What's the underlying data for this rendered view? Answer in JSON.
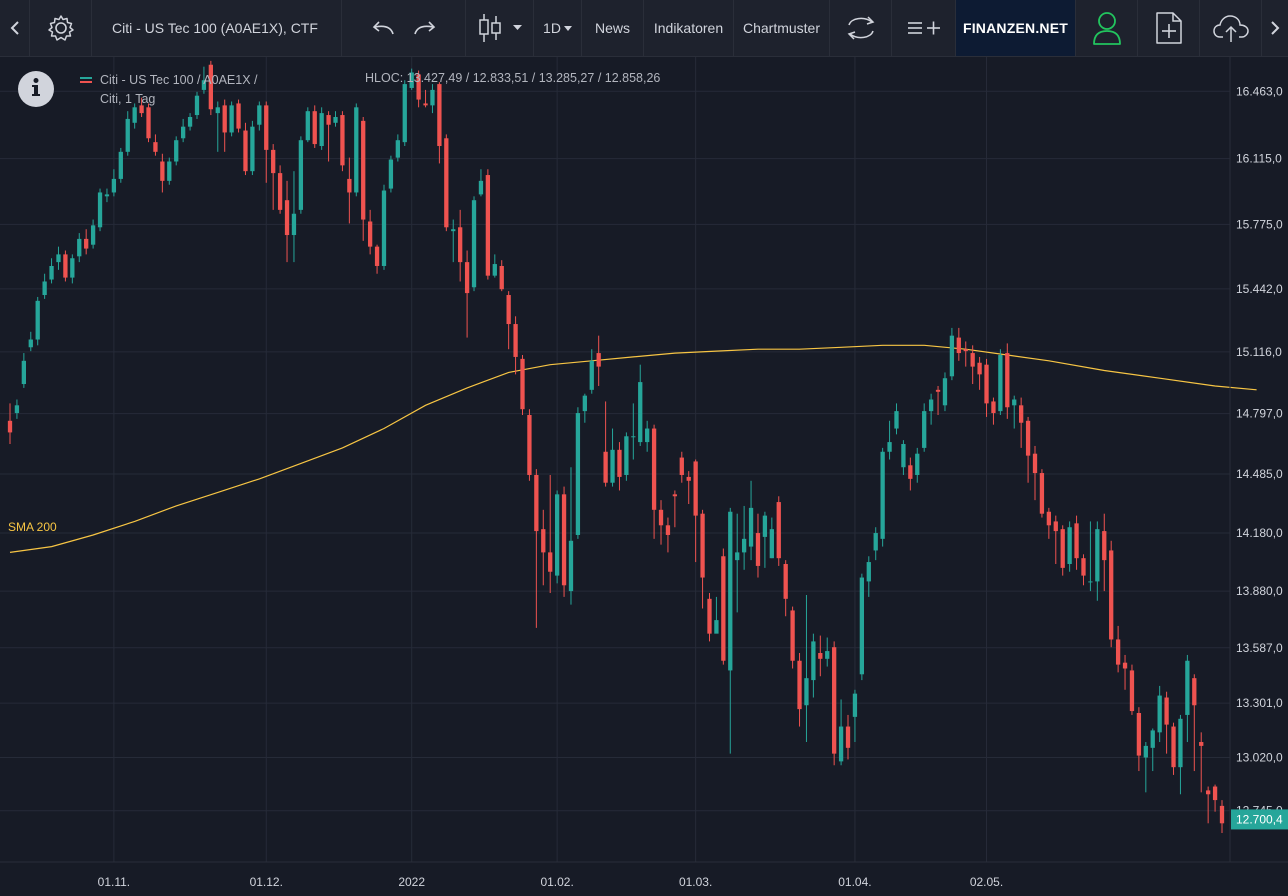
{
  "toolbar": {
    "symbol_title": "Citi - US Tec 100 (A0AE1X), CTF",
    "interval": "1D",
    "news": "News",
    "indicators": "Indikatoren",
    "patterns": "Chartmuster",
    "brand": "FINANZEN.NET"
  },
  "legend": {
    "line1": "Citi - US Tec 100 / A0AE1X /",
    "line2": "Citi, 1 Tag",
    "hloc": "HLOC: 13.427,49 / 12.833,51 / 13.285,27 / 12.858,26"
  },
  "sma_label": "SMA 200",
  "colors": {
    "up": "#26a69a",
    "down": "#ef5350",
    "sma": "#f7c544",
    "background": "#171b26",
    "grid": "#262b38"
  },
  "chart_data": {
    "type": "candlestick",
    "ylim": [
      12480,
      16640
    ],
    "y_ticks": [
      {
        "value": 16463,
        "label": "16.463,0"
      },
      {
        "value": 16115,
        "label": "16.115,0"
      },
      {
        "value": 15775,
        "label": "15.775,0"
      },
      {
        "value": 15442,
        "label": "15.442,0"
      },
      {
        "value": 15116,
        "label": "15.116,0"
      },
      {
        "value": 14797,
        "label": "14.797,0"
      },
      {
        "value": 14485,
        "label": "14.485,0"
      },
      {
        "value": 14180,
        "label": "14.180,0"
      },
      {
        "value": 13880,
        "label": "13.880,0"
      },
      {
        "value": 13587,
        "label": "13.587,0"
      },
      {
        "value": 13301,
        "label": "13.301,0"
      },
      {
        "value": 13020,
        "label": "13.020,0"
      },
      {
        "value": 12745,
        "label": "12.745,0"
      }
    ],
    "x_ticks": [
      {
        "index": 15,
        "label": "01.11."
      },
      {
        "index": 37,
        "label": "01.12."
      },
      {
        "index": 58,
        "label": "2022"
      },
      {
        "index": 79,
        "label": "01.02."
      },
      {
        "index": 99,
        "label": "01.03."
      },
      {
        "index": 122,
        "label": "01.04."
      },
      {
        "index": 141,
        "label": "02.05."
      }
    ],
    "last_price": {
      "value": 12700,
      "label": "12.700,4"
    },
    "candles": [
      [
        14760,
        14700,
        14850,
        14640
      ],
      [
        14800,
        14840,
        14870,
        14770
      ],
      [
        14950,
        15070,
        15110,
        14930
      ],
      [
        15140,
        15180,
        15220,
        15120
      ],
      [
        15180,
        15380,
        15400,
        15150
      ],
      [
        15410,
        15480,
        15520,
        15390
      ],
      [
        15490,
        15560,
        15600,
        15470
      ],
      [
        15580,
        15620,
        15660,
        15540
      ],
      [
        15620,
        15500,
        15640,
        15480
      ],
      [
        15500,
        15600,
        15620,
        15470
      ],
      [
        15610,
        15700,
        15730,
        15580
      ],
      [
        15700,
        15650,
        15750,
        15620
      ],
      [
        15670,
        15770,
        15800,
        15650
      ],
      [
        15760,
        15940,
        15960,
        15740
      ],
      [
        15920,
        15930,
        15960,
        15890
      ],
      [
        15940,
        16010,
        16060,
        15920
      ],
      [
        16010,
        16150,
        16170,
        15990
      ],
      [
        16150,
        16320,
        16360,
        16130
      ],
      [
        16300,
        16380,
        16400,
        16270
      ],
      [
        16390,
        16350,
        16430,
        16330
      ],
      [
        16380,
        16220,
        16400,
        16200
      ],
      [
        16200,
        16150,
        16240,
        16130
      ],
      [
        16100,
        16000,
        16140,
        15940
      ],
      [
        16000,
        16100,
        16120,
        15980
      ],
      [
        16100,
        16210,
        16230,
        16080
      ],
      [
        16220,
        16280,
        16320,
        16200
      ],
      [
        16280,
        16330,
        16350,
        16260
      ],
      [
        16340,
        16440,
        16460,
        16320
      ],
      [
        16470,
        16520,
        16590,
        16450
      ],
      [
        16600,
        16370,
        16620,
        16340
      ],
      [
        16350,
        16380,
        16410,
        16150
      ],
      [
        16390,
        16250,
        16420,
        16150
      ],
      [
        16250,
        16390,
        16410,
        16230
      ],
      [
        16400,
        16270,
        16420,
        16250
      ],
      [
        16260,
        16050,
        16300,
        16030
      ],
      [
        16050,
        16280,
        16310,
        16030
      ],
      [
        16290,
        16390,
        16410,
        16260
      ],
      [
        16390,
        16160,
        16410,
        15990
      ],
      [
        16160,
        16040,
        16190,
        15850
      ],
      [
        16040,
        15850,
        16080,
        15830
      ],
      [
        15900,
        15720,
        16000,
        15580
      ],
      [
        15720,
        15830,
        16050,
        15580
      ],
      [
        15850,
        16210,
        16230,
        15830
      ],
      [
        16210,
        16360,
        16380,
        16200
      ],
      [
        16360,
        16190,
        16390,
        16170
      ],
      [
        16180,
        16350,
        16380,
        16160
      ],
      [
        16340,
        16290,
        16360,
        16100
      ],
      [
        16300,
        16330,
        16360,
        16280
      ],
      [
        16340,
        16080,
        16360,
        16050
      ],
      [
        16010,
        15940,
        16120,
        15780
      ],
      [
        15940,
        16380,
        16400,
        15920
      ],
      [
        16310,
        15800,
        16330,
        15690
      ],
      [
        15790,
        15660,
        15850,
        15620
      ],
      [
        15660,
        15560,
        15670,
        15520
      ],
      [
        15560,
        15950,
        15980,
        15540
      ],
      [
        15960,
        16110,
        16130,
        15940
      ],
      [
        16120,
        16210,
        16240,
        16100
      ],
      [
        16200,
        16500,
        16520,
        16180
      ],
      [
        16480,
        16560,
        16580,
        16470
      ],
      [
        16550,
        16420,
        16570,
        16380
      ],
      [
        16400,
        16390,
        16470,
        16380
      ],
      [
        16390,
        16470,
        16500,
        16350
      ],
      [
        16500,
        16180,
        16510,
        16090
      ],
      [
        16220,
        15760,
        16240,
        15740
      ],
      [
        15740,
        15750,
        15800,
        15580
      ],
      [
        15760,
        15580,
        15850,
        15480
      ],
      [
        15580,
        15420,
        15640,
        15190
      ],
      [
        15450,
        15900,
        15920,
        15430
      ],
      [
        15930,
        16000,
        16060,
        15920
      ],
      [
        16030,
        15510,
        16060,
        15490
      ],
      [
        15510,
        15570,
        15620,
        15500
      ],
      [
        15560,
        15440,
        15590,
        15430
      ],
      [
        15410,
        15260,
        15430,
        15130
      ],
      [
        15260,
        15090,
        15300,
        15000
      ],
      [
        15080,
        14820,
        15100,
        14790
      ],
      [
        14790,
        14480,
        14820,
        14450
      ],
      [
        14480,
        14190,
        14510,
        13690
      ],
      [
        14200,
        14080,
        14300,
        13910
      ],
      [
        14080,
        13980,
        14480,
        13870
      ],
      [
        13960,
        14380,
        14400,
        13920
      ],
      [
        14380,
        13910,
        14420,
        13850
      ],
      [
        13880,
        14140,
        14520,
        13810
      ],
      [
        14170,
        14800,
        14830,
        14150
      ],
      [
        14810,
        14890,
        14900,
        14750
      ],
      [
        14920,
        15070,
        15130,
        14900
      ],
      [
        15110,
        15040,
        15200,
        14940
      ],
      [
        14600,
        14440,
        14860,
        14420
      ],
      [
        14440,
        14610,
        14720,
        14420
      ],
      [
        14610,
        14470,
        14650,
        14400
      ],
      [
        14480,
        14680,
        14700,
        14450
      ],
      [
        14680,
        14680,
        14850,
        14560
      ],
      [
        14650,
        14960,
        15050,
        14630
      ],
      [
        14650,
        14720,
        14760,
        14600
      ],
      [
        14720,
        14300,
        14740,
        14150
      ],
      [
        14300,
        14220,
        14350,
        14120
      ],
      [
        14220,
        14170,
        14260,
        14080
      ],
      [
        14380,
        14370,
        14400,
        14210
      ],
      [
        14570,
        14480,
        14600,
        14440
      ],
      [
        14470,
        14450,
        14500,
        14330
      ],
      [
        14550,
        14270,
        14560,
        14030
      ],
      [
        14280,
        13950,
        14300,
        13790
      ],
      [
        13840,
        13660,
        13870,
        13620
      ],
      [
        13660,
        13730,
        13850,
        13680
      ],
      [
        14060,
        13520,
        14100,
        13500
      ],
      [
        13470,
        14290,
        14310,
        13040
      ],
      [
        14040,
        14080,
        14280,
        13770
      ],
      [
        14080,
        14150,
        14320,
        13990
      ],
      [
        14110,
        14310,
        14450,
        14040
      ],
      [
        14180,
        14010,
        14280,
        13950
      ],
      [
        14160,
        14270,
        14290,
        14000
      ],
      [
        14050,
        14200,
        14260,
        14050
      ],
      [
        14340,
        14050,
        14370,
        14010
      ],
      [
        14020,
        13840,
        14040,
        13750
      ],
      [
        13780,
        13520,
        13800,
        13480
      ],
      [
        13520,
        13270,
        13560,
        13180
      ],
      [
        13290,
        13430,
        13860,
        13100
      ],
      [
        13420,
        13620,
        13660,
        13330
      ],
      [
        13560,
        13530,
        13650,
        13440
      ],
      [
        13530,
        13570,
        13640,
        13490
      ],
      [
        13590,
        13040,
        13620,
        12980
      ],
      [
        13000,
        13180,
        13320,
        12980
      ],
      [
        13180,
        13070,
        13240,
        13010
      ],
      [
        13230,
        13350,
        13370,
        13100
      ],
      [
        13450,
        13950,
        13970,
        13420
      ],
      [
        13930,
        14030,
        14060,
        13850
      ],
      [
        14090,
        14180,
        14210,
        14040
      ],
      [
        14150,
        14600,
        14620,
        14110
      ],
      [
        14600,
        14650,
        14760,
        14560
      ],
      [
        14720,
        14810,
        14850,
        14690
      ],
      [
        14520,
        14640,
        14660,
        14480
      ],
      [
        14530,
        14460,
        14570,
        14400
      ],
      [
        14480,
        14590,
        14620,
        14440
      ],
      [
        14620,
        14810,
        14850,
        14600
      ],
      [
        14810,
        14870,
        14900,
        14740
      ],
      [
        14920,
        14910,
        14940,
        14790
      ],
      [
        14840,
        14980,
        15010,
        14810
      ],
      [
        14990,
        15200,
        15240,
        14970
      ],
      [
        15190,
        15110,
        15240,
        15070
      ],
      [
        15130,
        15120,
        15170,
        15040
      ],
      [
        15110,
        15040,
        15150,
        14950
      ],
      [
        15060,
        15000,
        15090,
        14920
      ],
      [
        15050,
        14850,
        15080,
        14780
      ],
      [
        14860,
        14800,
        14880,
        14740
      ],
      [
        14810,
        15100,
        15130,
        14790
      ],
      [
        15110,
        14830,
        15160,
        14770
      ],
      [
        14840,
        14870,
        14890,
        14720
      ],
      [
        14840,
        14750,
        14880,
        14620
      ],
      [
        14760,
        14580,
        14780,
        14440
      ],
      [
        14590,
        14490,
        14630,
        14350
      ],
      [
        14490,
        14280,
        14510,
        14260
      ],
      [
        14290,
        14220,
        14310,
        14150
      ],
      [
        14240,
        14190,
        14270,
        14020
      ],
      [
        14200,
        14000,
        14220,
        13960
      ],
      [
        14020,
        14210,
        14240,
        13980
      ],
      [
        14230,
        14050,
        14270,
        13990
      ],
      [
        14050,
        13960,
        14070,
        13910
      ],
      [
        13930,
        13930,
        14240,
        13880
      ],
      [
        13930,
        14200,
        14240,
        13830
      ],
      [
        14190,
        14040,
        14280,
        13880
      ],
      [
        14090,
        13630,
        14140,
        13590
      ],
      [
        13630,
        13500,
        13700,
        13460
      ],
      [
        13510,
        13480,
        13550,
        13370
      ],
      [
        13470,
        13260,
        13500,
        13240
      ],
      [
        13250,
        13030,
        13280,
        12950
      ],
      [
        13020,
        13080,
        13100,
        12840
      ],
      [
        13070,
        13160,
        13170,
        12950
      ],
      [
        13150,
        13340,
        13390,
        13100
      ],
      [
        13330,
        13190,
        13360,
        13040
      ],
      [
        13180,
        12970,
        13200,
        12930
      ],
      [
        12970,
        13220,
        13240,
        12830
      ],
      [
        13240,
        13520,
        13550,
        13100
      ],
      [
        13430,
        13290,
        13450,
        12950
      ],
      [
        13100,
        13080,
        13150,
        12840
      ],
      [
        12850,
        12830,
        12870,
        12680
      ],
      [
        12870,
        12800,
        12880,
        12740
      ],
      [
        12770,
        12680,
        12800,
        12630
      ]
    ],
    "sma200": [
      [
        0,
        14080
      ],
      [
        6,
        14110
      ],
      [
        12,
        14170
      ],
      [
        18,
        14240
      ],
      [
        24,
        14320
      ],
      [
        30,
        14390
      ],
      [
        36,
        14460
      ],
      [
        42,
        14540
      ],
      [
        48,
        14620
      ],
      [
        54,
        14720
      ],
      [
        60,
        14840
      ],
      [
        66,
        14930
      ],
      [
        72,
        15010
      ],
      [
        78,
        15050
      ],
      [
        84,
        15070
      ],
      [
        90,
        15090
      ],
      [
        96,
        15110
      ],
      [
        102,
        15120
      ],
      [
        108,
        15130
      ],
      [
        114,
        15130
      ],
      [
        120,
        15140
      ],
      [
        126,
        15150
      ],
      [
        132,
        15150
      ],
      [
        138,
        15130
      ],
      [
        144,
        15100
      ],
      [
        150,
        15070
      ],
      [
        158,
        15020
      ],
      [
        166,
        14980
      ],
      [
        174,
        14940
      ],
      [
        180,
        14920
      ]
    ]
  }
}
